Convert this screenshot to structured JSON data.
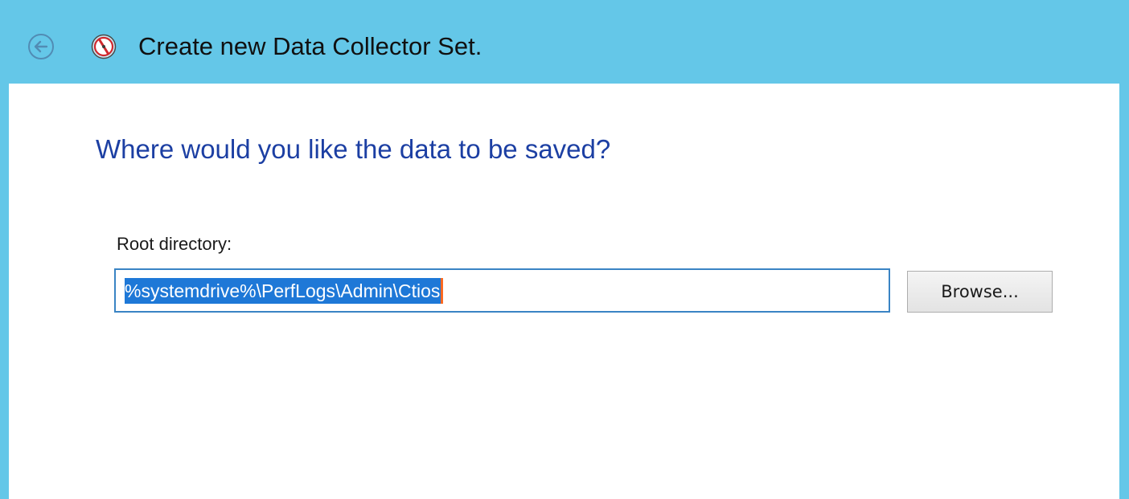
{
  "window": {
    "title": "Create new Data Collector Set.",
    "back_icon": "back-arrow-icon",
    "app_icon": "performance-monitor-icon"
  },
  "page": {
    "heading": "Where would you like the data to be saved?"
  },
  "root_directory": {
    "label": "Root directory:",
    "value": "%systemdrive%\\PerfLogs\\Admin\\Ctios",
    "value_selected": true
  },
  "buttons": {
    "browse_label": "Browse..."
  },
  "colors": {
    "titlebar": "#64c7e8",
    "heading": "#1c3fa3",
    "selection": "#1e78d7",
    "input_border": "#3a84c4"
  }
}
